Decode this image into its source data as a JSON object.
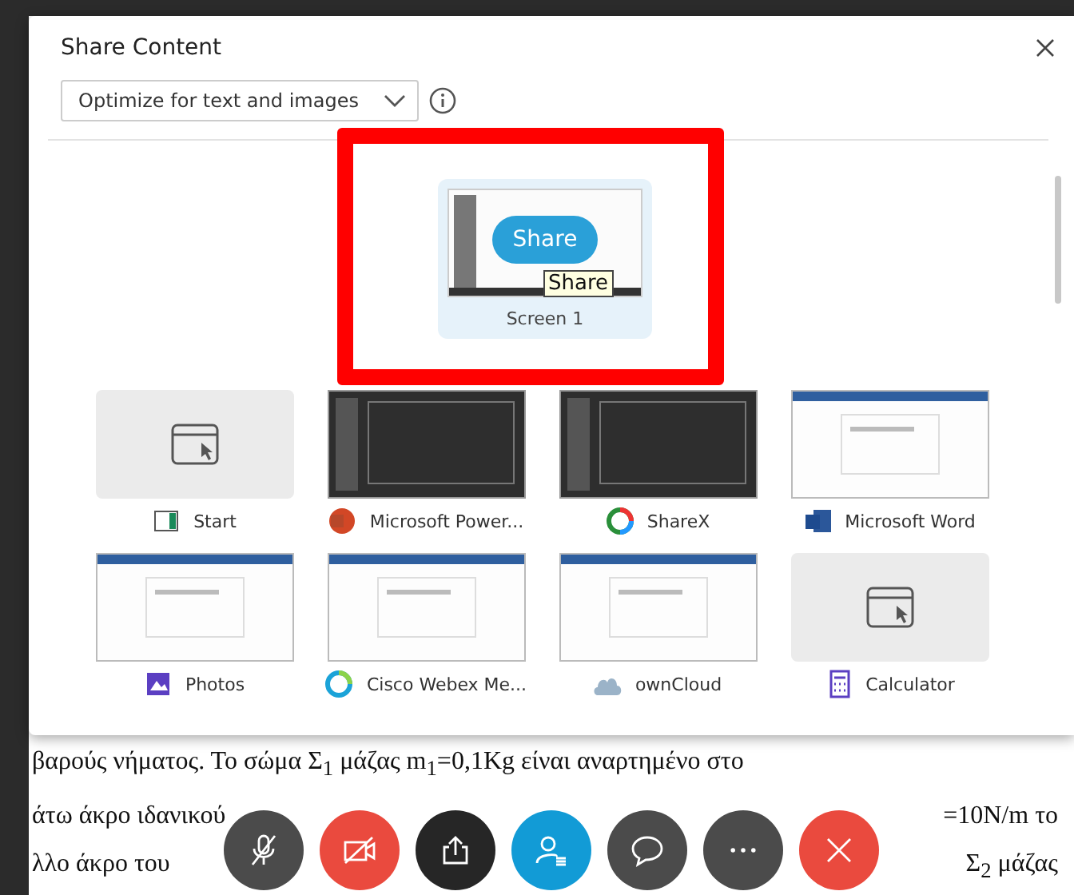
{
  "dialog": {
    "title": "Share Content",
    "optimize": {
      "value": "Optimize for text and images"
    },
    "screens": [
      {
        "label": "Screen 1",
        "selected": true,
        "highlighted": true,
        "button": "Share",
        "tooltip": "Share"
      }
    ],
    "apps": [
      {
        "label": "Start",
        "kind": "start",
        "has_preview": false
      },
      {
        "label": "Microsoft Power...",
        "kind": "powerpoint",
        "has_preview": true
      },
      {
        "label": "ShareX",
        "kind": "sharex",
        "has_preview": true
      },
      {
        "label": "Microsoft Word",
        "kind": "word",
        "has_preview": true
      },
      {
        "label": "Photos",
        "kind": "photos",
        "has_preview": true
      },
      {
        "label": "Cisco Webex Me...",
        "kind": "webex",
        "has_preview": true
      },
      {
        "label": "ownCloud",
        "kind": "owncloud",
        "has_preview": true
      },
      {
        "label": "Calculator",
        "kind": "calculator",
        "has_preview": false
      }
    ]
  },
  "document": {
    "lines": [
      {
        "left": "βαρούς νήματος. Το σώμα Σ$_{1}$ μάζας m$_{1}$=0,1Kg είναι αναρτημένο στο"
      },
      {
        "left": "άτω άκρο ιδανικού",
        "right": "=10N/m το"
      },
      {
        "left": "λλο άκρο του",
        "right": "Σ$_{2}$ μάζας"
      }
    ]
  },
  "toolbar": [
    {
      "kind": "mute"
    },
    {
      "kind": "video"
    },
    {
      "kind": "share"
    },
    {
      "kind": "participants"
    },
    {
      "kind": "chat"
    },
    {
      "kind": "more"
    },
    {
      "kind": "end"
    }
  ]
}
